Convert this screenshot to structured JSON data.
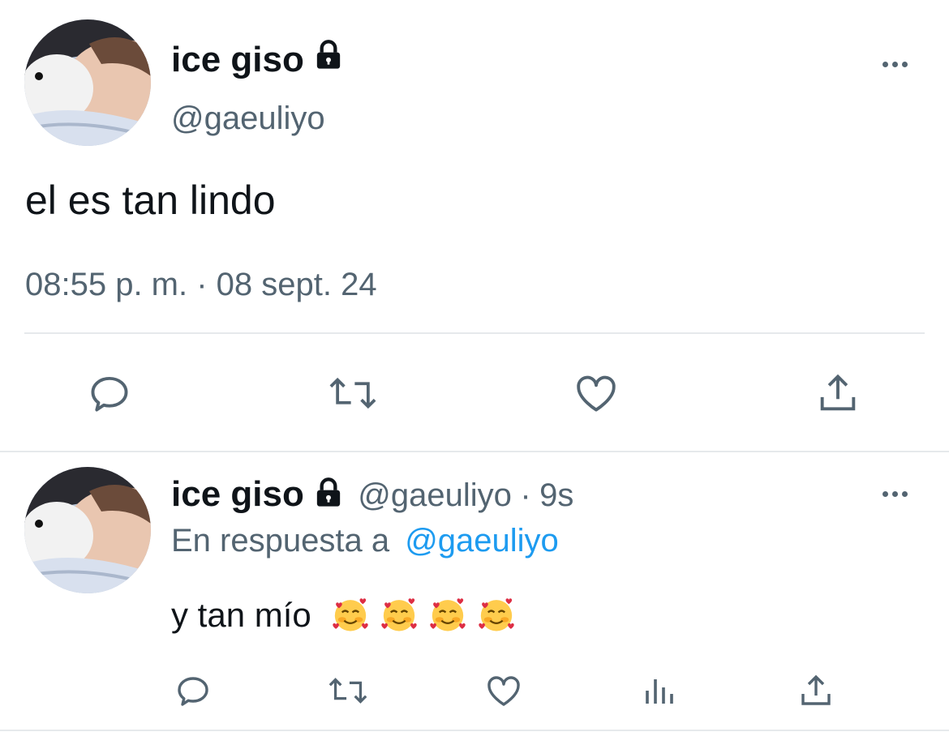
{
  "main_tweet": {
    "display_name": "ice giso",
    "handle": "@gaeuliyo",
    "text": "el es tan lindo",
    "timestamp": "08:55 p. m. · 08 sept. 24",
    "icons": [
      "reply-icon",
      "retweet-icon",
      "like-icon",
      "share-icon"
    ]
  },
  "reply_tweet": {
    "display_name": "ice giso",
    "handle": "@gaeuliyo",
    "separator": "·",
    "time": "9s",
    "replying_prefix": "En respuesta a",
    "replying_to": "@gaeuliyo",
    "text": "y tan mío",
    "emoji_count": 4,
    "emoji_name": "smiling-face-with-hearts",
    "icons": [
      "reply-icon",
      "retweet-icon",
      "like-icon",
      "views-icon",
      "share-icon"
    ]
  },
  "colors": {
    "text_primary": "#0f1419",
    "text_secondary": "#536471",
    "accent": "#1d9bf0",
    "divider": "#e6e9ec"
  }
}
